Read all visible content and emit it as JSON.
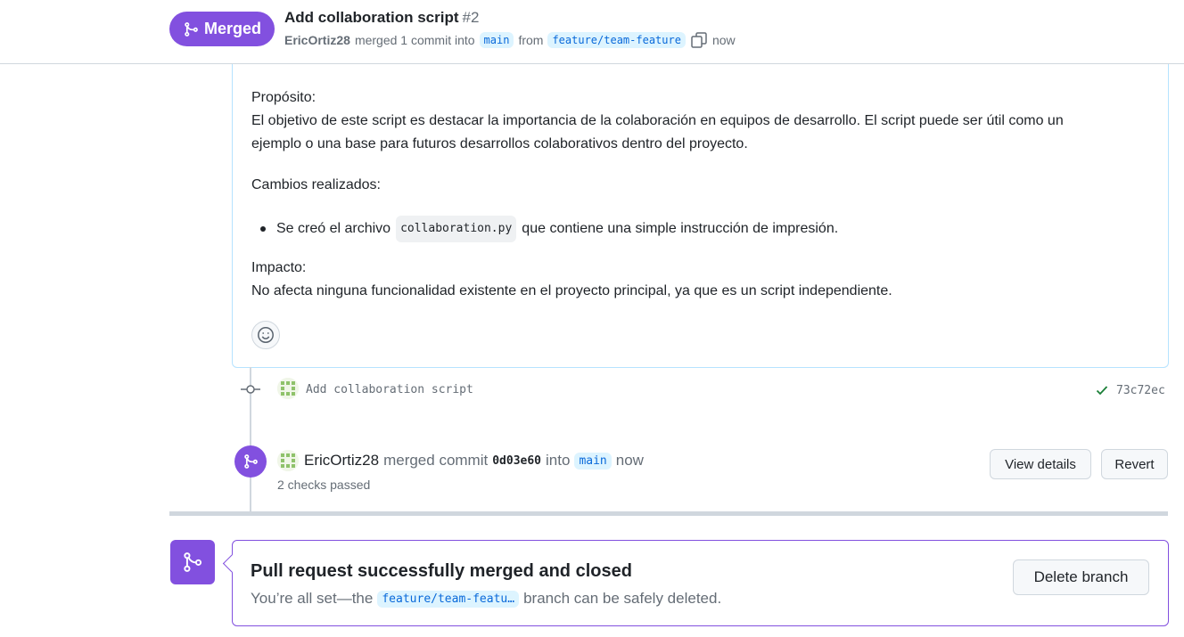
{
  "header": {
    "status_label": "Merged",
    "title": "Add collaboration script",
    "number": "#2",
    "author": "EricOrtiz28",
    "merged_text": "merged 1 commit into",
    "base_branch": "main",
    "from_text": "from",
    "head_branch": "feature/team-feature",
    "time": "now"
  },
  "comment": {
    "purpose_heading": "Propósito:",
    "purpose_line1": "El objetivo de este script es destacar la importancia de la colaboración en equipos de desarrollo. El script puede ser útil como un",
    "purpose_line2": "ejemplo o una base para futuros desarrollos colaborativos dentro del proyecto.",
    "changes_heading": "Cambios realizados:",
    "change_item_before": "Se creó el archivo",
    "change_item_code": "collaboration.py",
    "change_item_after": "que contiene una simple instrucción de impresión.",
    "impact_heading": "Impacto:",
    "impact_text": "No afecta ninguna funcionalidad existente en el proyecto principal, ya que es un script independiente."
  },
  "timeline": {
    "commit_message": "Add collaboration script",
    "commit_sha": "73c72ec",
    "merge_user": "EricOrtiz28",
    "merge_text": "merged commit",
    "merge_sha": "0d03e60",
    "into_text": "into",
    "merge_branch": "main",
    "merge_time": "now",
    "checks": "2 checks passed",
    "view_details_label": "View details",
    "revert_label": "Revert"
  },
  "merged_box": {
    "title": "Pull request successfully merged and closed",
    "sub_before": "You’re all set—the",
    "branch": "feature/team-featu…",
    "sub_after": "branch can be safely deleted.",
    "delete_label": "Delete branch"
  },
  "colors": {
    "merged_purple": "#8250df",
    "success_green": "#1a7f37",
    "branch_bg": "#ddf4ff",
    "branch_fg": "#0969da"
  }
}
